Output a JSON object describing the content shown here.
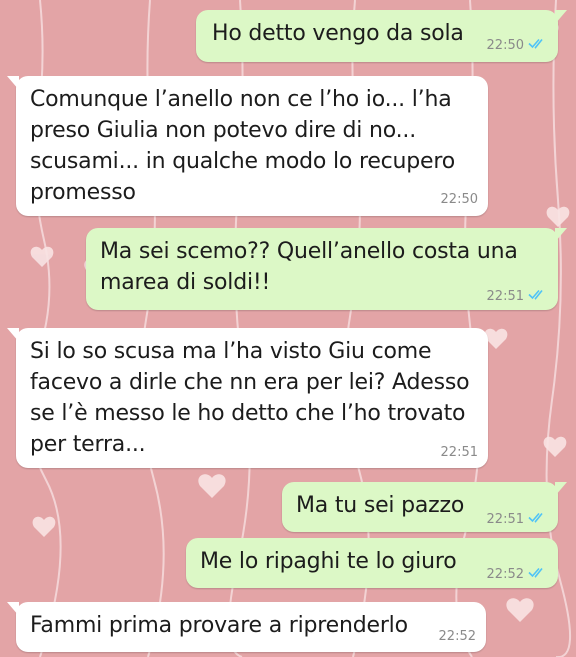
{
  "chat": {
    "messages": [
      {
        "direction": "out",
        "text": "Ho detto vengo da sola",
        "time": "22:50",
        "status_icon": "double-check-read-icon"
      },
      {
        "direction": "in",
        "text": "Comunque l’anello non ce l’ho io... l’ha\npreso Giulia non potevo dire di no...\nscusami... in qualche modo lo recupero\npromesso",
        "time": "22:50"
      },
      {
        "direction": "out",
        "text": "Ma sei scemo?? Quell’anello costa una\nmarea di soldi!!",
        "time": "22:51",
        "status_icon": "double-check-read-icon"
      },
      {
        "direction": "in",
        "text": "Si lo so scusa ma l’ha visto Giu come\nfacevo a dirle che nn era per lei? Adesso\nse l’è messo le ho detto che l’ho trovato\nper terra...",
        "time": "22:51"
      },
      {
        "direction": "out",
        "text": "Ma tu sei pazzo",
        "time": "22:51",
        "status_icon": "double-check-read-icon"
      },
      {
        "direction": "out",
        "text": "Me lo ripaghi te lo giuro",
        "time": "22:52",
        "status_icon": "double-check-read-icon"
      },
      {
        "direction": "in",
        "text": "Fammi prima provare a riprenderlo",
        "time": "22:52"
      }
    ]
  },
  "colors": {
    "background": "#e3a4a6",
    "outgoing_bubble": "#dcf8c6",
    "incoming_bubble": "#ffffff",
    "read_tick": "#4fc3f7"
  }
}
